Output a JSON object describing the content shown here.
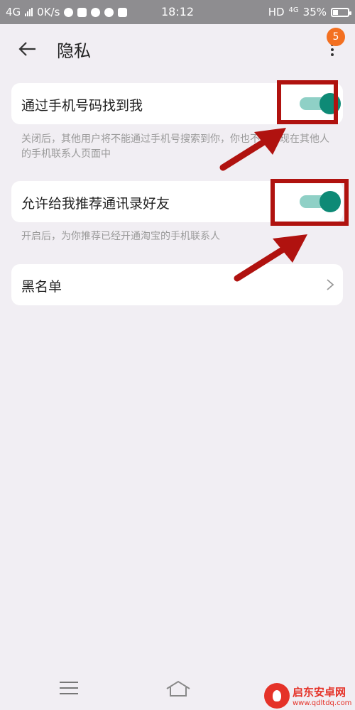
{
  "status_bar": {
    "network": "4G",
    "speed": "0K/s",
    "time": "18:12",
    "hd": "HD",
    "net_right": "4G",
    "battery": "35%",
    "battery_level": 0.35
  },
  "header": {
    "title": "隐私",
    "badge_count": "5"
  },
  "settings": {
    "find_by_phone": {
      "label": "通过手机号码找到我",
      "enabled": true,
      "description": "关闭后，其他用户将不能通过手机号搜索到你，你也不会出现在其他人的手机联系人页面中"
    },
    "recommend_contacts": {
      "label": "允许给我推荐通讯录好友",
      "enabled": true,
      "description": "开启后，为你推荐已经开通淘宝的手机联系人"
    },
    "blacklist": {
      "label": "黑名单"
    }
  },
  "watermark": {
    "name": "启东安卓网",
    "url": "www.qdltdq.com"
  },
  "colors": {
    "toggle_on": "#0e8a76",
    "annotation": "#b0120f",
    "badge": "#f37021"
  },
  "icons": [
    "back-arrow-icon",
    "more-vert-icon",
    "chevron-right-icon",
    "menu-icon",
    "home-icon"
  ]
}
